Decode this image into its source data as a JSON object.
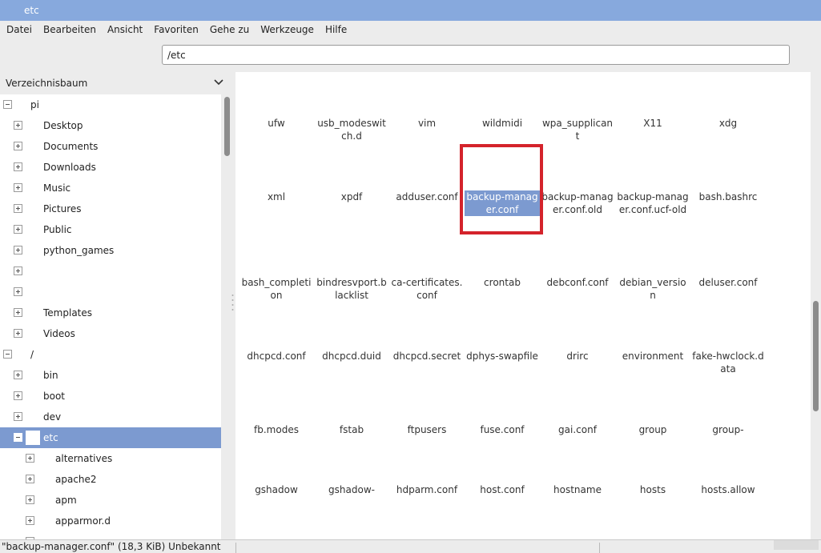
{
  "window": {
    "title": "etc"
  },
  "menu": [
    "Datei",
    "Bearbeiten",
    "Ansicht",
    "Favoriten",
    "Gehe zu",
    "Werkzeuge",
    "Hilfe"
  ],
  "path": {
    "value": "/etc"
  },
  "sidebar": {
    "header": "Verzeichnisbaum",
    "tree": [
      {
        "label": "pi",
        "expander": "minus",
        "indent": 0
      },
      {
        "label": "Desktop",
        "expander": "plus",
        "indent": 1
      },
      {
        "label": "Documents",
        "expander": "plus",
        "indent": 1
      },
      {
        "label": "Downloads",
        "expander": "plus",
        "indent": 1
      },
      {
        "label": "Music",
        "expander": "plus",
        "indent": 1
      },
      {
        "label": "Pictures",
        "expander": "plus",
        "indent": 1
      },
      {
        "label": "Public",
        "expander": "plus",
        "indent": 1
      },
      {
        "label": "python_games",
        "expander": "plus",
        "indent": 1
      },
      {
        "label": "",
        "expander": "plus",
        "indent": 1
      },
      {
        "label": "",
        "expander": "plus",
        "indent": 1
      },
      {
        "label": "Templates",
        "expander": "plus",
        "indent": 1
      },
      {
        "label": "Videos",
        "expander": "plus",
        "indent": 1
      },
      {
        "label": "/",
        "expander": "minus",
        "indent": 0
      },
      {
        "label": "bin",
        "expander": "plus",
        "indent": 1
      },
      {
        "label": "boot",
        "expander": "plus",
        "indent": 1
      },
      {
        "label": "dev",
        "expander": "plus",
        "indent": 1
      },
      {
        "label": "etc",
        "expander": "minus",
        "indent": 1,
        "selected": true
      },
      {
        "label": "alternatives",
        "expander": "plus",
        "indent": 2
      },
      {
        "label": "apache2",
        "expander": "plus",
        "indent": 2
      },
      {
        "label": "apm",
        "expander": "plus",
        "indent": 2
      },
      {
        "label": "apparmor.d",
        "expander": "plus",
        "indent": 2
      },
      {
        "label": "",
        "expander": "plus",
        "indent": 2
      }
    ]
  },
  "files": [
    [
      "ufw",
      "usb_modeswitch.d",
      "vim",
      "wildmidi",
      "wpa_supplicant",
      "X11",
      "xdg"
    ],
    [
      "xml",
      "xpdf",
      "adduser.conf",
      "backup-manager.conf",
      "backup-manager.conf.old",
      "backup-manager.conf.ucf-old",
      "bash.bashrc"
    ],
    [
      "bash_completion",
      "bindresvport.blacklist",
      "ca-certificates.conf",
      "crontab",
      "debconf.conf",
      "debian_version",
      "deluser.conf"
    ],
    [
      "dhcpcd.conf",
      "dhcpcd.duid",
      "dhcpcd.secret",
      "dphys-swapfile",
      "drirc",
      "environment",
      "fake-hwclock.data"
    ],
    [
      "fb.modes",
      "fstab",
      "ftpusers",
      "fuse.conf",
      "gai.conf",
      "group",
      "group-"
    ],
    [
      "gshadow",
      "gshadow-",
      "hdparm.conf",
      "host.conf",
      "hostname",
      "hosts",
      "hosts.allow"
    ]
  ],
  "selected_file": "backup-manager.conf",
  "status": {
    "text": "\"backup-manager.conf\" (18,3 KiB) Unbekannt"
  },
  "colors": {
    "titlebar": "#87a9dd",
    "selection": "#7c9ad0",
    "highlight_box": "#d4232b"
  }
}
